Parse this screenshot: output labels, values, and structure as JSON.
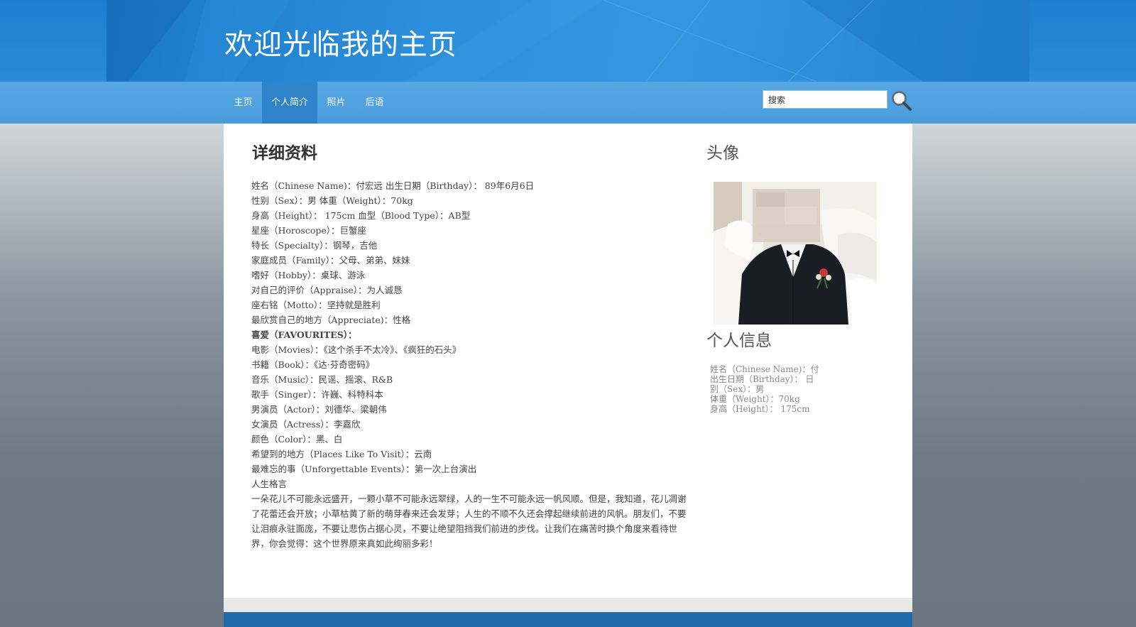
{
  "site": {
    "title": "欢迎光临我的主页"
  },
  "nav": {
    "items": [
      {
        "label": "主页"
      },
      {
        "label": "个人简介"
      },
      {
        "label": "照片"
      },
      {
        "label": "后语"
      }
    ],
    "active_index": 1
  },
  "search": {
    "value": "搜索"
  },
  "detail": {
    "heading": "详细资料",
    "lines": [
      "姓名（Chinese Name)：付宏远  出生日期（Birthday）： 89年6月6日",
      "性别（Sex）：男   体重（Weight）：70kg",
      "身高（Height）： 175cm  血型（Blood Type）：AB型",
      "星座（Horoscope）：巨蟹座",
      "特长（Specialty）：钢琴，吉他",
      "家庭成员（Family）：父母、弟弟、妹妹",
      "嗜好（Hobby）：桌球、游泳",
      "对自己的评价（Appraise）：为人诚恳",
      "座右铭（Motto）：坚持就是胜利",
      "最欣赏自己的地方（Appreciate)：性格",
      "喜爱（FAVOURITES）：",
      "电影（Movies）：《这个杀手不太冷》、《疯狂的石头》",
      "书籍（Book）：《达·芬奇密码》",
      "音乐（Music）：民谣、摇滚、R&B",
      "歌手（Singer）：许巍、科特科本",
      "男演员（Actor）：刘德华、梁朝伟",
      "女演员（Actress）：李嘉欣",
      "颜色（Color）：黑、白",
      "希望到的地方（Places Like To Visit）：云南",
      "最难忘的事（Unforgettable Events）：第一次上台演出",
      "人生格言"
    ],
    "motto": "一朵花儿不可能永远盛开，一颗小草不可能永远翠绿，人的一生不可能永远一帆风顺。但是，我知道，花儿凋谢了花蕾还会开放；小草枯黄了新的萌芽春来还会发芽；人生的不顺不久还会撑起继续前进的风帆。朋友们，不要让泪痕永驻面庞，不要让悲伤占据心灵，不要让绝望阻挡我们前进的步伐。让我们在痛苦时换个角度来看待世界，你会觉得：这个世界原来真如此绚丽多彩！"
  },
  "sidebar": {
    "avatar_heading": "头像",
    "info_heading": "个人信息",
    "info_lines": [
      "姓名（Chinese Name)：付",
      "出生日期（Birthday）：      日",
      "别（Sex）：男",
      "体重（Weight）：70kg",
      "身高（Height）： 175cm"
    ]
  }
}
